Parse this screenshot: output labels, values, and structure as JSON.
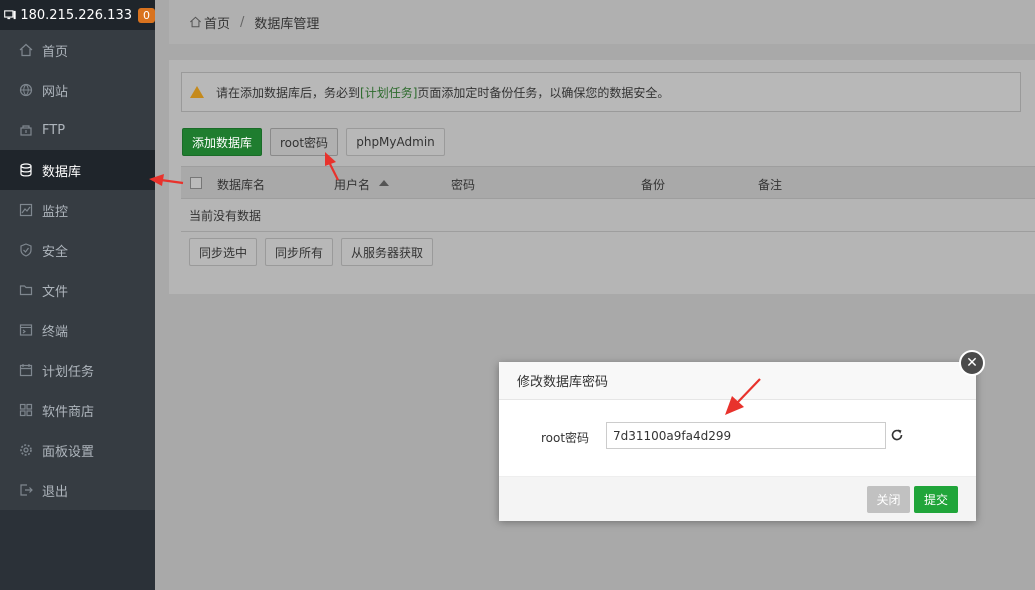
{
  "sidebar": {
    "server_ip": "180.215.226.133",
    "server_badge": "0",
    "items": [
      {
        "label": "首页",
        "icon": "home-icon"
      },
      {
        "label": "网站",
        "icon": "globe-icon"
      },
      {
        "label": "FTP",
        "icon": "ftp-icon"
      },
      {
        "label": "数据库",
        "icon": "database-icon"
      },
      {
        "label": "监控",
        "icon": "monitor-icon"
      },
      {
        "label": "安全",
        "icon": "shield-icon"
      },
      {
        "label": "文件",
        "icon": "folder-icon"
      },
      {
        "label": "终端",
        "icon": "terminal-icon"
      },
      {
        "label": "计划任务",
        "icon": "calendar-icon"
      },
      {
        "label": "软件商店",
        "icon": "apps-icon"
      },
      {
        "label": "面板设置",
        "icon": "gear-icon"
      },
      {
        "label": "退出",
        "icon": "logout-icon"
      }
    ],
    "active_index": 3
  },
  "breadcrumb": {
    "home": "首页",
    "separator": "/",
    "current": "数据库管理"
  },
  "alert": {
    "prefix": "请在添加数据库后，务必到",
    "link": "[计划任务]",
    "suffix": "页面添加定时备份任务，以确保您的数据安全。"
  },
  "toolbar": {
    "add_db": "添加数据库",
    "root_password": "root密码",
    "phpmyadmin": "phpMyAdmin"
  },
  "table": {
    "columns": [
      "数据库名",
      "用户名",
      "密码",
      "备份",
      "备注"
    ],
    "empty_text": "当前没有数据"
  },
  "bottom_actions": {
    "sync_selected": "同步选中",
    "sync_all": "同步所有",
    "fetch_from_server": "从服务器获取"
  },
  "modal": {
    "title": "修改数据库密码",
    "field_label": "root密码",
    "field_value": "7d31100a9fa4d299",
    "close_label": "关闭",
    "submit_label": "提交"
  },
  "colors": {
    "sidebar_bg": "#2b3138",
    "accent_green": "#20a53a",
    "warning_orange": "#d9731f",
    "annotation_red": "#e8322c"
  }
}
